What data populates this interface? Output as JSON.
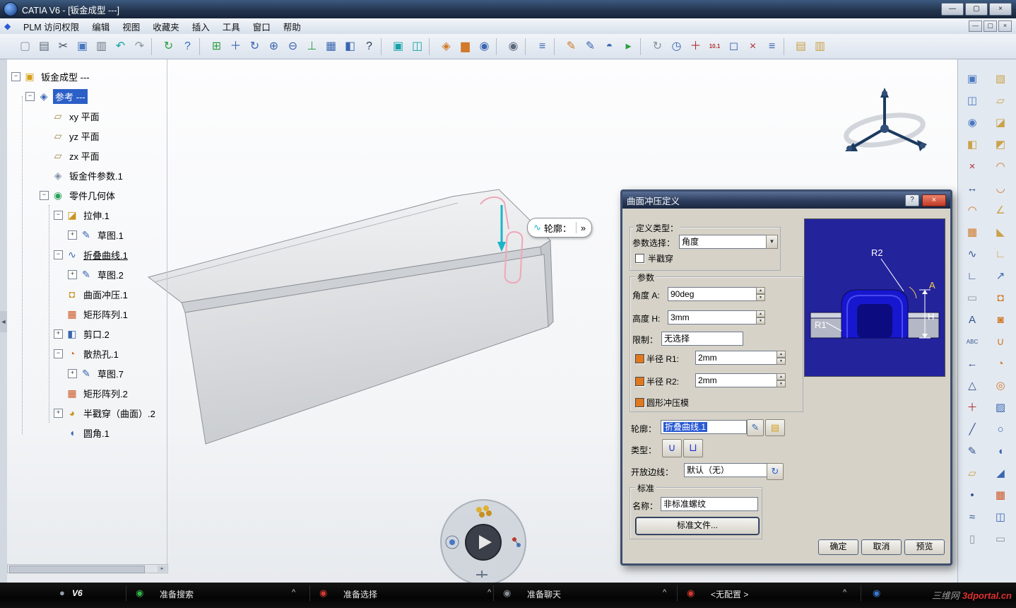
{
  "window": {
    "title": "CATIA V6 - [钣金成型 ---]",
    "min": "—",
    "max": "▢",
    "close": "×"
  },
  "menubar": {
    "items": [
      "PLM 访问权限",
      "编辑",
      "视图",
      "收藏夹",
      "插入",
      "工具",
      "窗口",
      "帮助"
    ]
  },
  "toolbar": {
    "icons": [
      {
        "name": "new-document-icon",
        "glyph": "▢",
        "color": "#8a94a2"
      },
      {
        "name": "print-icon",
        "glyph": "▤",
        "color": "#5d6b7d"
      },
      {
        "name": "cut-icon",
        "glyph": "✂",
        "color": "#3b4a5c"
      },
      {
        "name": "copy-icon",
        "glyph": "▣",
        "color": "#4a78c0"
      },
      {
        "name": "paste-icon",
        "glyph": "▥",
        "color": "#6b7684"
      },
      {
        "name": "undo-icon",
        "glyph": "↶",
        "color": "#17a2a8"
      },
      {
        "name": "redo-icon",
        "glyph": "↷",
        "color": "#8a94a0"
      },
      {
        "sep": true
      },
      {
        "name": "update-icon",
        "glyph": "↻",
        "color": "#2f9e44"
      },
      {
        "name": "context-help-icon",
        "glyph": "?",
        "color": "#2f6fc0"
      },
      {
        "sep": true
      },
      {
        "name": "fit-all-icon",
        "glyph": "⊞",
        "color": "#2f9e44"
      },
      {
        "name": "pan-icon",
        "glyph": "＋",
        "color": "#3a66b0"
      },
      {
        "name": "rotate-view-icon",
        "glyph": "↻",
        "color": "#3a66b0"
      },
      {
        "name": "zoom-in-icon",
        "glyph": "⊕",
        "color": "#3a66b0"
      },
      {
        "name": "zoom-out-icon",
        "glyph": "⊖",
        "color": "#3a66b0"
      },
      {
        "name": "normal-view-icon",
        "glyph": "⊥",
        "color": "#2f9e44"
      },
      {
        "name": "multi-view-icon",
        "glyph": "▦",
        "color": "#3a66b0"
      },
      {
        "name": "render-style-icon",
        "glyph": "◧",
        "color": "#3a66b0"
      },
      {
        "name": "help-icon",
        "glyph": "?",
        "color": "#2b3a4f"
      },
      {
        "sep": true
      },
      {
        "name": "screen-layout-icon",
        "glyph": "▣",
        "color": "#17a2a8"
      },
      {
        "name": "second-screen-icon",
        "glyph": "◫",
        "color": "#17a2a8"
      },
      {
        "sep": true
      },
      {
        "name": "catalog-icon",
        "glyph": "◈",
        "color": "#d07a2a"
      },
      {
        "name": "chart-icon",
        "glyph": "▆",
        "color": "#d07a2a"
      },
      {
        "name": "knowledge-icon",
        "glyph": "◉",
        "color": "#3a66b0"
      },
      {
        "sep": true
      },
      {
        "name": "camera-icon",
        "glyph": "◉",
        "color": "#5d6b7d"
      },
      {
        "sep": true
      },
      {
        "name": "simulation-icon",
        "glyph": "≡",
        "color": "#3a66b0"
      },
      {
        "sep": true
      },
      {
        "name": "sketch-tracer-icon",
        "glyph": "✎",
        "color": "#d07a2a"
      },
      {
        "name": "surface-paint-icon",
        "glyph": "✎",
        "color": "#3a66b0"
      },
      {
        "name": "globe-icon",
        "glyph": "◓",
        "color": "#3a66b0"
      },
      {
        "name": "nature-icon",
        "glyph": "▸",
        "color": "#2f9e44"
      },
      {
        "sep": true
      },
      {
        "name": "refresh-icon",
        "glyph": "↻",
        "color": "#8a94a0"
      },
      {
        "name": "clock-icon",
        "glyph": "◷",
        "color": "#3a66b0"
      },
      {
        "name": "axis-icon",
        "glyph": "＋",
        "color": "#b03030"
      },
      {
        "name": "measure-update-icon",
        "glyph": "10.1",
        "color": "#b03030"
      },
      {
        "name": "cube-icon",
        "glyph": "◻",
        "color": "#3a66b0"
      },
      {
        "name": "delete-tool-icon",
        "glyph": "×",
        "color": "#b03030"
      },
      {
        "name": "list-icon",
        "glyph": "≡",
        "color": "#3a66b0"
      },
      {
        "sep": true
      },
      {
        "name": "catalog-browser-icon",
        "glyph": "▤",
        "color": "#caa24a"
      },
      {
        "name": "library-icon",
        "glyph": "▥",
        "color": "#caa24a"
      }
    ]
  },
  "tree": {
    "root": {
      "name": "tree-root-sheetmetal",
      "label": "钣金成型 ---",
      "glyph": "▣",
      "color": "#d4a017"
    },
    "reference": {
      "name": "tree-item-reference",
      "label": "参考 ---",
      "glyph": "◈",
      "color": "#3a66b0"
    },
    "items": [
      {
        "name": "tree-item-xy-plane",
        "label": "xy 平面",
        "glyph": "▱",
        "color": "#9a8348",
        "level": 1,
        "expand": ""
      },
      {
        "name": "tree-item-yz-plane",
        "label": "yz 平面",
        "glyph": "▱",
        "color": "#9a8348",
        "level": 1,
        "expand": ""
      },
      {
        "name": "tree-item-zx-plane",
        "label": "zx 平面",
        "glyph": "▱",
        "color": "#9a8348",
        "level": 1,
        "expand": ""
      },
      {
        "name": "tree-item-sheetmetal-params",
        "label": "钣金件参数.1",
        "glyph": "◈",
        "color": "#8090a8",
        "level": 1,
        "expand": ""
      },
      {
        "name": "tree-item-part-body",
        "label": "零件几何体",
        "glyph": "◉",
        "color": "#2aa05a",
        "level": 1,
        "expand": "−"
      },
      {
        "name": "tree-item-wall",
        "label": "拉伸.1",
        "glyph": "◪",
        "color": "#c8951e",
        "level": 2,
        "expand": "−"
      },
      {
        "name": "tree-item-sketch-1",
        "label": "草图.1",
        "glyph": "✎",
        "color": "#3a66b0",
        "level": 3,
        "expand": "+"
      },
      {
        "name": "tree-item-fold-curve",
        "label": "折叠曲线.1",
        "glyph": "∿",
        "color": "#3a66b0",
        "level": 2,
        "expand": "−",
        "underline": true
      },
      {
        "name": "tree-item-sketch-2",
        "label": "草图.2",
        "glyph": "✎",
        "color": "#3a66b0",
        "level": 3,
        "expand": "+"
      },
      {
        "name": "tree-item-surface-stamp",
        "label": "曲面冲压.1",
        "glyph": "◘",
        "color": "#c8951e",
        "level": 2,
        "expand": ""
      },
      {
        "name": "tree-item-rect-pattern-1",
        "label": "矩形阵列.1",
        "glyph": "▦",
        "color": "#cc5522",
        "level": 2,
        "expand": ""
      },
      {
        "name": "tree-item-cutout",
        "label": "剪口.2",
        "glyph": "◧",
        "color": "#3a66b0",
        "level": 2,
        "expand": "+"
      },
      {
        "name": "tree-item-louver",
        "label": "散热孔.1",
        "glyph": "◔",
        "color": "#cc6a22",
        "level": 2,
        "expand": "−"
      },
      {
        "name": "tree-item-sketch-7",
        "label": "草图.7",
        "glyph": "✎",
        "color": "#3a66b0",
        "level": 3,
        "expand": "+"
      },
      {
        "name": "tree-item-rect-pattern-2",
        "label": "矩形阵列.2",
        "glyph": "▦",
        "color": "#cc5522",
        "level": 2,
        "expand": ""
      },
      {
        "name": "tree-item-half-pierce",
        "label": "半戳穿（曲面）.2",
        "glyph": "◕",
        "color": "#c8951e",
        "level": 2,
        "expand": "+"
      },
      {
        "name": "tree-item-fillet",
        "label": "圆角.1",
        "glyph": "◖",
        "color": "#3a66b0",
        "level": 2,
        "expand": ""
      }
    ]
  },
  "viewport": {
    "tooltip": {
      "label": "轮廓：",
      "more": "»",
      "icon_glyph": "∿"
    }
  },
  "dialog": {
    "title": "曲面冲压定义",
    "titlebar": {
      "help": "?",
      "close": "×"
    },
    "definition_type": {
      "group_label": "定义类型：",
      "param_label": "参数选择：",
      "param_value": "角度",
      "half_pierce_label": "半戳穿",
      "half_pierce_checked": false
    },
    "parameters": {
      "group_label": "参数",
      "angle_label": "角度 A:",
      "angle_value": "90deg",
      "height_label": "高度 H:",
      "height_value": "3mm",
      "limit_label": "限制：",
      "limit_value": "无选择",
      "r1_label": "半径 R1:",
      "r1_value": "2mm",
      "r1_checked": true,
      "r2_label": "半径 R2:",
      "r2_value": "2mm",
      "r2_checked": true,
      "round_die_label": "圆形冲压模",
      "round_die_checked": true
    },
    "profile": {
      "label": "轮廓：",
      "value": "折叠曲线.1"
    },
    "type": {
      "label": "类型：",
      "btn1_glyph": "∪",
      "btn2_glyph": "⊔"
    },
    "open_edge": {
      "label": "开放边线：",
      "value": "默认（无）",
      "icon_glyph": "↻"
    },
    "standard": {
      "group_label": "标准",
      "name_label": "名称：",
      "name_value": "非标准螺纹",
      "file_button": "标准文件..."
    },
    "preview": {
      "r1": "R1",
      "r2": "R2",
      "a": "A",
      "h": "H"
    },
    "buttons": {
      "ok": "确定",
      "cancel": "取消",
      "preview": "预览"
    }
  },
  "right_dock": {
    "inner": [
      {
        "name": "viewpoint-icon",
        "glyph": "▣",
        "color": "#4a78c0"
      },
      {
        "name": "capture-icon",
        "glyph": "◫",
        "color": "#4a78c0"
      },
      {
        "name": "magnifier-icon",
        "glyph": "◉",
        "color": "#4a78c0"
      },
      {
        "name": "section-icon",
        "glyph": "◧",
        "color": "#caa24a"
      },
      {
        "name": "clash-icon",
        "glyph": "×",
        "color": "#b03030"
      },
      {
        "name": "distance-icon",
        "glyph": "↔",
        "color": "#31548e"
      },
      {
        "name": "arc-tool-icon",
        "glyph": "◠",
        "color": "#d07a2a"
      },
      {
        "name": "grid-icon",
        "glyph": "▦",
        "color": "#d07a2a"
      },
      {
        "name": "spline-icon",
        "glyph": "∿",
        "color": "#31548e"
      },
      {
        "name": "corner-tool-icon",
        "glyph": "∟",
        "color": "#31548e"
      },
      {
        "name": "dxf-export-icon",
        "glyph": "▭",
        "color": "#8a94a0"
      },
      {
        "name": "text-tool-icon",
        "glyph": "A",
        "color": "#31548e"
      },
      {
        "name": "annotation-icon",
        "glyph": "ABC",
        "color": "#31548e"
      },
      {
        "name": "leader-icon",
        "glyph": "←",
        "color": "#31548e"
      },
      {
        "name": "datum-icon",
        "glyph": "△",
        "color": "#31548e"
      },
      {
        "name": "axis-system-icon",
        "glyph": "＋",
        "color": "#b03030"
      },
      {
        "name": "line-tool-icon",
        "glyph": "╱",
        "color": "#31548e"
      },
      {
        "name": "pencil-tool-icon",
        "glyph": "✎",
        "color": "#31548e"
      },
      {
        "name": "plane-tool-icon",
        "glyph": "▱",
        "color": "#caa24a"
      },
      {
        "name": "point-tool-icon",
        "glyph": "•",
        "color": "#31548e"
      },
      {
        "name": "sweep-icon",
        "glyph": "≈",
        "color": "#31548e"
      },
      {
        "name": "bin-icon",
        "glyph": "▯",
        "color": "#8a94a0"
      }
    ],
    "outer": [
      {
        "name": "recognize-icon",
        "glyph": "▧",
        "color": "#caa24a"
      },
      {
        "name": "wall-icon",
        "glyph": "▱",
        "color": "#caa24a"
      },
      {
        "name": "wall-on-edge-icon",
        "glyph": "◪",
        "color": "#caa24a"
      },
      {
        "name": "extrusion-icon",
        "glyph": "◩",
        "color": "#caa24a"
      },
      {
        "name": "flange-icon",
        "glyph": "◠",
        "color": "#d07a2a"
      },
      {
        "name": "hem-icon",
        "glyph": "◡",
        "color": "#d07a2a"
      },
      {
        "name": "bend-icon",
        "glyph": "∠",
        "color": "#caa24a"
      },
      {
        "name": "conical-bend-icon",
        "glyph": "◣",
        "color": "#caa24a"
      },
      {
        "name": "fold-icon",
        "glyph": "∟",
        "color": "#caa24a"
      },
      {
        "name": "unfold-icon",
        "glyph": "↗",
        "color": "#3a66b0"
      },
      {
        "name": "point-stamp-icon",
        "glyph": "◘",
        "color": "#d07a2a"
      },
      {
        "name": "surface-stamp-icon",
        "glyph": "◙",
        "color": "#d07a2a"
      },
      {
        "name": "bead-icon",
        "glyph": "∪",
        "color": "#d07a2a"
      },
      {
        "name": "louver-icon",
        "glyph": "◔",
        "color": "#d07a2a"
      },
      {
        "name": "flanged-hole-icon",
        "glyph": "◎",
        "color": "#d07a2a"
      },
      {
        "name": "cutout-icon",
        "glyph": "▨",
        "color": "#3a66b0"
      },
      {
        "name": "hole-icon",
        "glyph": "○",
        "color": "#3a66b0"
      },
      {
        "name": "corner-relief-icon",
        "glyph": "◖",
        "color": "#3a66b0"
      },
      {
        "name": "chamfer-icon",
        "glyph": "◢",
        "color": "#3a66b0"
      },
      {
        "name": "pattern-icon",
        "glyph": "▦",
        "color": "#cc5522"
      },
      {
        "name": "mirror-icon",
        "glyph": "◫",
        "color": "#3a66b0"
      },
      {
        "name": "dxf-icon",
        "glyph": "▭",
        "color": "#8a94a0"
      }
    ]
  },
  "statusbar": {
    "brand": "V6",
    "sections": [
      {
        "name": "search-status",
        "glyph": "◉",
        "color": "#35b34a",
        "label": "准备搜索"
      },
      {
        "name": "select-status",
        "glyph": "◉",
        "color": "#d43a2f",
        "label": "准备选择"
      },
      {
        "name": "chat-status",
        "glyph": "◉",
        "color": "#8a8f98",
        "label": "准备聊天"
      },
      {
        "name": "config-status",
        "glyph": "◉",
        "color": "#d43a2f",
        "label": "<无配置 >"
      }
    ],
    "collapse": "^"
  },
  "watermark": {
    "prefix": "三维网",
    "site": "3dportal.cn"
  }
}
